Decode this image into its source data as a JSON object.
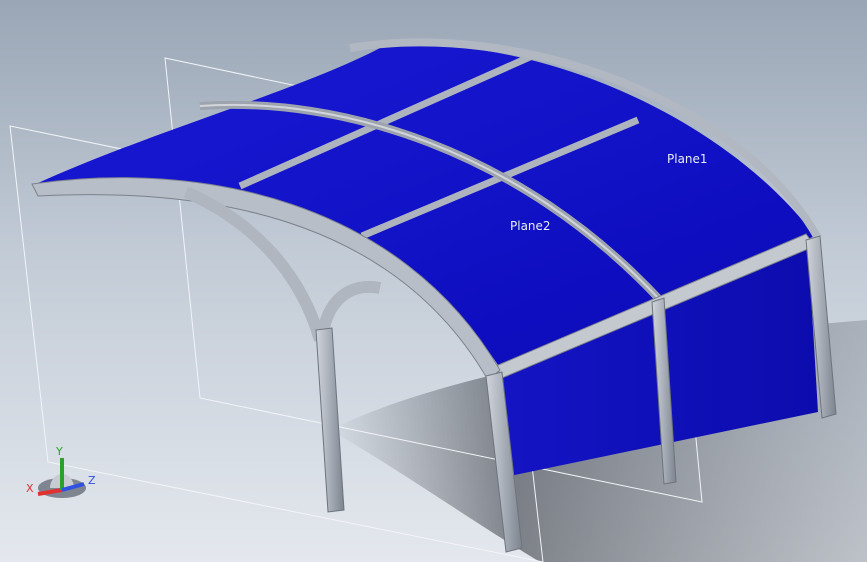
{
  "scene": {
    "planes": [
      {
        "name": "plane1",
        "label": "Plane1"
      },
      {
        "name": "plane2",
        "label": "Plane2"
      }
    ]
  },
  "triad": {
    "x_label": "X",
    "y_label": "Y",
    "z_label": "Z",
    "x_color": "#e03030",
    "y_color": "#2ca02c",
    "z_color": "#3050e0"
  },
  "colors": {
    "panel": "#1010c8",
    "frame": "#b6bcc6",
    "frame_dark": "#7c828c",
    "plane_line": "#f2f4f8"
  }
}
